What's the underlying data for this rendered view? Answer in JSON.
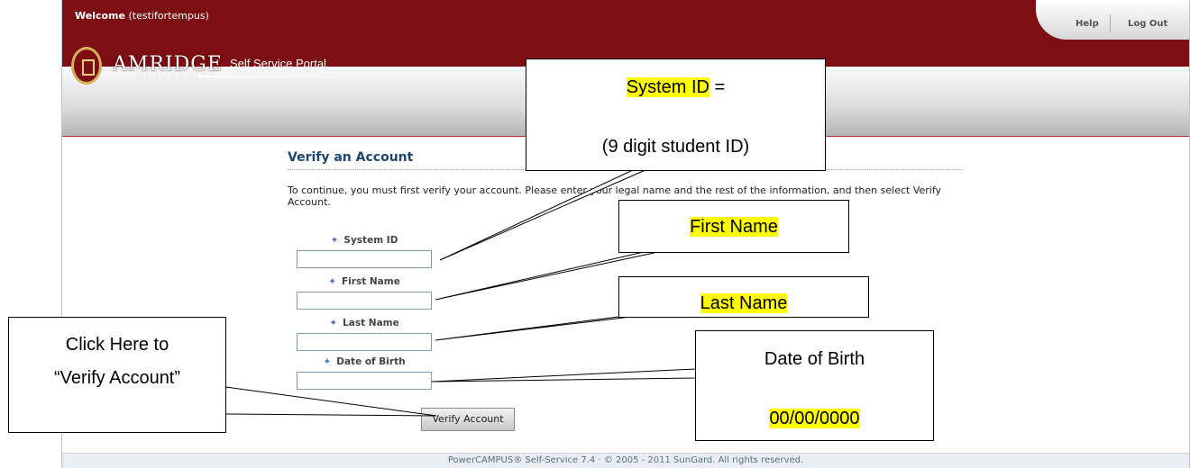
{
  "header": {
    "welcome_label": "Welcome",
    "welcome_user": "(testifortempus)",
    "help_link": "Help",
    "logout_link": "Log Out",
    "logo_name": "AMRIDGE",
    "logo_sub": "UNIVERSITY",
    "portal_name": "Self Service Portal"
  },
  "form": {
    "title": "Verify an Account",
    "instructions": "To continue, you must first verify your account. Please enter your legal name and the rest of the information, and then select Verify Account.",
    "fields": [
      {
        "label": "System ID",
        "value": ""
      },
      {
        "label": "First Name",
        "value": ""
      },
      {
        "label": "Last Name",
        "value": ""
      },
      {
        "label": "Date of Birth",
        "value": ""
      }
    ],
    "submit_label": "Verify Account"
  },
  "footer": {
    "text": "PowerCAMPUS® Self-Service 7.4 · © 2005 - 2011 SunGard. All rights reserved."
  },
  "callouts": {
    "system_id_term": "System ID",
    "system_id_eq": " =",
    "system_id_desc": "(9 digit student ID)",
    "first_name": "First Name",
    "last_name": "Last Name",
    "dob_label": "Date of Birth",
    "dob_format": "00/00/0000",
    "verify_line1": "Click Here to",
    "verify_line2": "“Verify Account”"
  },
  "colors": {
    "header_red": "#7d0e12",
    "title_blue": "#1d4670",
    "highlight": "#ffff00"
  }
}
